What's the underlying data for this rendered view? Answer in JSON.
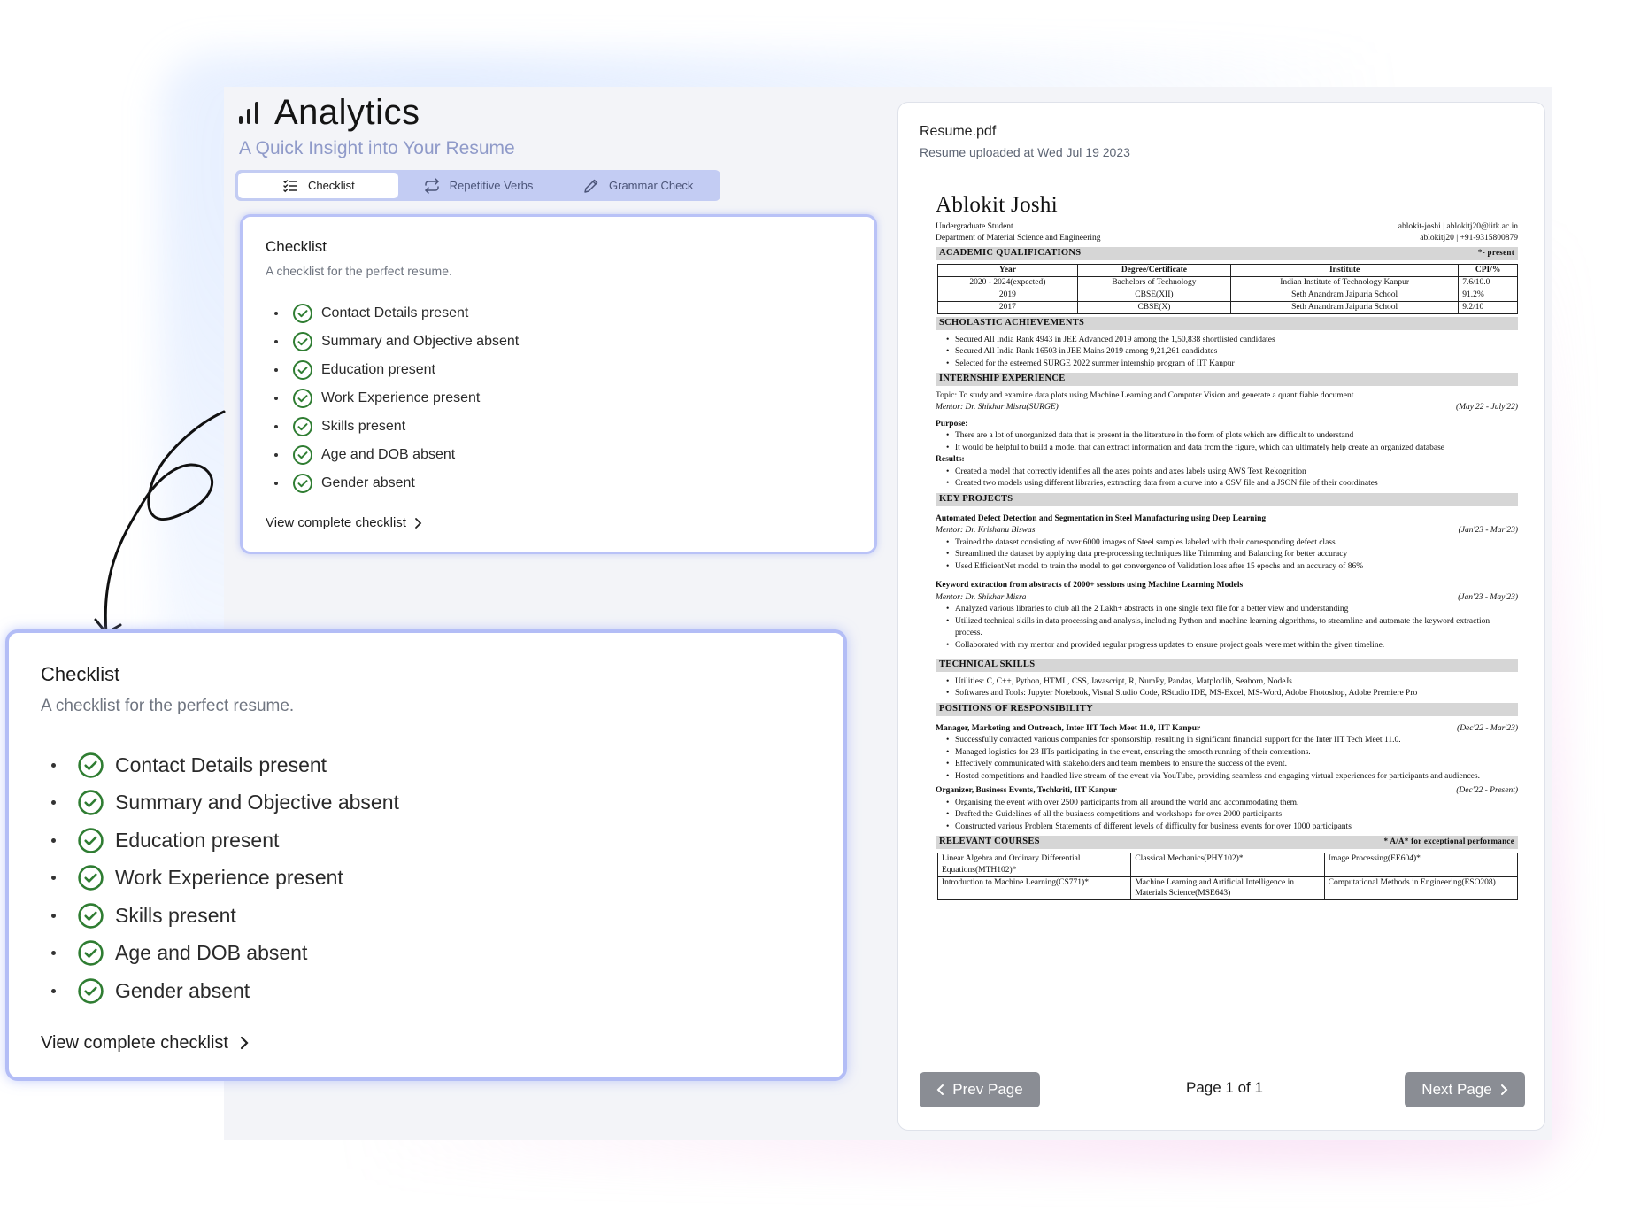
{
  "header": {
    "title": "Analytics",
    "subtitle": "A Quick Insight into Your Resume"
  },
  "tabs": [
    {
      "label": "Checklist",
      "icon": "list-check-icon",
      "active": true
    },
    {
      "label": "Repetitive Verbs",
      "icon": "repeat-icon",
      "active": false
    },
    {
      "label": "Grammar Check",
      "icon": "pencil-icon",
      "active": false
    }
  ],
  "checklist": {
    "title": "Checklist",
    "subtitle": "A checklist for the perfect resume.",
    "items": [
      "Contact Details present",
      "Summary and Objective absent",
      "Education present",
      "Work Experience present",
      "Skills present",
      "Age and DOB absent",
      "Gender absent"
    ],
    "link": "View complete checklist"
  },
  "colors": {
    "accent": "#b3bdf6",
    "check_green": "#2f7d32",
    "tab_bg": "#c3ccf3",
    "pager_gray": "#8a8d94"
  },
  "resume_panel": {
    "file_name": "Resume.pdf",
    "uploaded": "Resume uploaded at Wed Jul 19 2023",
    "prev": "Prev Page",
    "next": "Next Page",
    "page_info": "Page 1 of 1"
  },
  "resume": {
    "name": "Ablokit Joshi",
    "role": "Undergraduate Student",
    "dept": "Department of Material Science and Engineering",
    "contact1": "ablokit-joshi | ablokitj20@iitk.ac.in",
    "contact2": "ablokitj20 | +91-9315800879",
    "sec_academic": "ACADEMIC QUALIFICATIONS",
    "sec_academic_note": "*- present",
    "table_head": [
      "Year",
      "Degree/Certificate",
      "Institute",
      "CPI/%"
    ],
    "table_rows": [
      [
        "2020 - 2024(expected)",
        "Bachelors of Technology",
        "Indian Institute of Technology Kanpur",
        "7.6/10.0"
      ],
      [
        "2019",
        "CBSE(XII)",
        "Seth Anandram Jaipuria School",
        "91.2%"
      ],
      [
        "2017",
        "CBSE(X)",
        "Seth Anandram Jaipuria School",
        "9.2/10"
      ]
    ],
    "sec_scholastic": "SCHOLASTIC ACHIEVEMENTS",
    "scholastic": [
      "Secured All India Rank 4943 in JEE Advanced 2019 among the 1,50,838 shortlisted candidates",
      "Secured All India Rank 16503 in JEE Mains 2019 among 9,21,261 candidates",
      "Selected for the esteemed SURGE 2022 summer internship program of IIT Kanpur"
    ],
    "sec_intern": "INTERNSHIP EXPERIENCE",
    "intern_topic": "Topic: To study and examine data plots using Machine Learning and Computer Vision and generate a quantifiable document",
    "intern_mentor": "Mentor: Dr. Shikhar Misra(SURGE)",
    "intern_dates": "(May'22 - July'22)",
    "purpose_label": "Purpose:",
    "purpose": [
      "There are a lot of unorganized data that is present in the literature in the form of plots which are difficult to understand",
      "It would be helpful to build a model that can extract information and data from the figure, which can ultimately help create an organized database"
    ],
    "results_label": "Results:",
    "results": [
      "Created a model that correctly identifies all the axes points and axes labels using AWS Text Rekognition",
      "Created two models using different libraries, extracting data from a curve into a CSV file and a JSON file of their coordinates"
    ],
    "sec_projects": "KEY PROJECTS",
    "p1_title": "Automated Defect Detection and Segmentation in Steel Manufacturing using Deep Learning",
    "p1_mentor": "Mentor: Dr. Krishanu Biswas",
    "p1_dates": "(Jan'23 - Mar'23)",
    "p1": [
      "Trained the dataset consisting of over 6000 images of Steel samples labeled with their corresponding defect class",
      "Streamlined the dataset by applying data pre-processing techniques like Trimming and Balancing for better accuracy",
      "Used EfficientNet model to train the model to get convergence of Validation loss after 15 epochs and an accuracy of 86%"
    ],
    "p2_title": "Keyword extraction from abstracts of 2000+ sessions using Machine Learning Models",
    "p2_mentor": "Mentor: Dr. Shikhar Misra",
    "p2_dates": "(Jan'23 - May'23)",
    "p2": [
      "Analyzed various libraries to club all the 2 Lakh+ abstracts in one single text file for a better view and understanding",
      "Utilized technical skills in data processing and analysis, including Python and machine learning algorithms, to streamline and automate the keyword extraction process.",
      "Collaborated with my mentor and provided regular progress updates to ensure project goals were met within the given timeline."
    ],
    "sec_skills": "TECHNICAL SKILLS",
    "skills": [
      "Utilities: C, C++, Python, HTML, CSS, Javascript, R, NumPy, Pandas, Matplotlib, Seaborn, NodeJs",
      "Softwares and Tools: Jupyter Notebook, Visual Studio Code, RStudio IDE, MS-Excel, MS-Word, Adobe Photoshop, Adobe Premiere Pro"
    ],
    "sec_por": "POSITIONS OF RESPONSIBILITY",
    "por1_title": "Manager, Marketing and Outreach, Inter IIT Tech Meet 11.0, IIT Kanpur",
    "por1_dates": "(Dec'22 - Mar'23)",
    "por1": [
      "Successfully contacted various companies for sponsorship, resulting in significant financial support for the Inter IIT Tech Meet 11.0.",
      "Managed logistics for 23 IITs participating in the event, ensuring the smooth running of their contentions.",
      "Effectively communicated with stakeholders and team members to ensure the success of the event.",
      "Hosted competitions and handled live stream of the event via YouTube, providing seamless and engaging virtual experiences for participants and audiences."
    ],
    "por2_title": "Organizer, Business Events, Techkriti, IIT Kanpur",
    "por2_dates": "(Dec'22 - Present)",
    "por2": [
      "Organising the event with over 2500 participants from all around the world and accommodating them.",
      "Drafted the Guidelines of all the business competitions and workshops for over 2000 participants",
      "Constructed various Problem Statements of different levels of difficulty for business events for over 1000 participants"
    ],
    "sec_courses": "RELEVANT COURSES",
    "sec_courses_note": "* A/A* for exceptional performance",
    "courses": [
      [
        "Linear Algebra and Ordinary Differential Equations(MTH102)*",
        "Classical Mechanics(PHY102)*",
        "Image Processing(EE604)*"
      ],
      [
        "Introduction to Machine Learning(CS771)*",
        "Machine Learning and Artificial Intelligence in Materials Science(MSE643)",
        "Computational Methods in Engineering(ESO208)"
      ]
    ]
  }
}
